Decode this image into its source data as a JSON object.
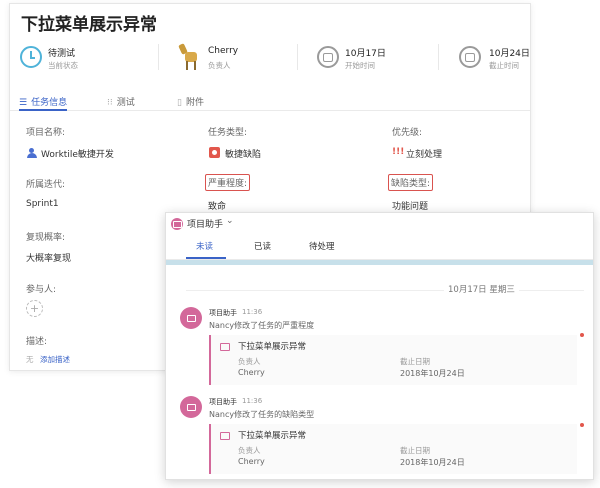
{
  "task": {
    "title": "下拉菜单展示异常",
    "header": [
      {
        "name": "待测试",
        "sub": "当前状态"
      },
      {
        "name": "Cherry",
        "sub": "负责人"
      },
      {
        "name": "10月17日",
        "sub": "开始时间"
      },
      {
        "name": "10月24日",
        "sub": "截止时间"
      }
    ],
    "tabs": [
      "任务信息",
      "测试",
      "附件"
    ],
    "fields": {
      "project_label": "项目名称:",
      "project_value": "Worktile敏捷开发",
      "type_label": "任务类型:",
      "type_value": "敏捷缺陷",
      "priority_label": "优先级:",
      "priority_mark": "!!!",
      "priority_value": "立刻处理",
      "iteration_label": "所属迭代:",
      "iteration_value": "Sprint1",
      "severity_label": "严重程度:",
      "severity_value": "致命",
      "defect_type_label": "缺陷类型:",
      "defect_type_value": "功能问题",
      "reproduce_label": "复现概率:",
      "reproduce_value": "大概率复现",
      "participants_label": "参与人:",
      "participants_add": "+",
      "desc_label": "描述:",
      "desc_none": "无",
      "desc_add": "添加描述"
    }
  },
  "messages": {
    "title": "项目助手",
    "tabs": [
      "未读",
      "已读",
      "待处理"
    ],
    "date_header": "10月17日 星期三",
    "items": [
      {
        "sender": "项目助手",
        "time": "11:36",
        "text": "Nancy修改了任务的严重程度",
        "card_title": "下拉菜单展示异常",
        "owner_label": "负责人",
        "owner": "Cherry",
        "due_label": "截止日期",
        "due": "2018年10月24日"
      },
      {
        "sender": "项目助手",
        "time": "11:36",
        "text": "Nancy修改了任务的缺陷类型",
        "card_title": "下拉菜单展示异常",
        "owner_label": "负责人",
        "owner": "Cherry",
        "due_label": "截止日期",
        "due": "2018年10月24日"
      }
    ]
  },
  "colors": {
    "accent": "#3a63c7",
    "assistant": "#d3689a",
    "defect": "#e2574c",
    "highlight_box": "#d9534f",
    "date_bar": "#c7e0ea"
  }
}
